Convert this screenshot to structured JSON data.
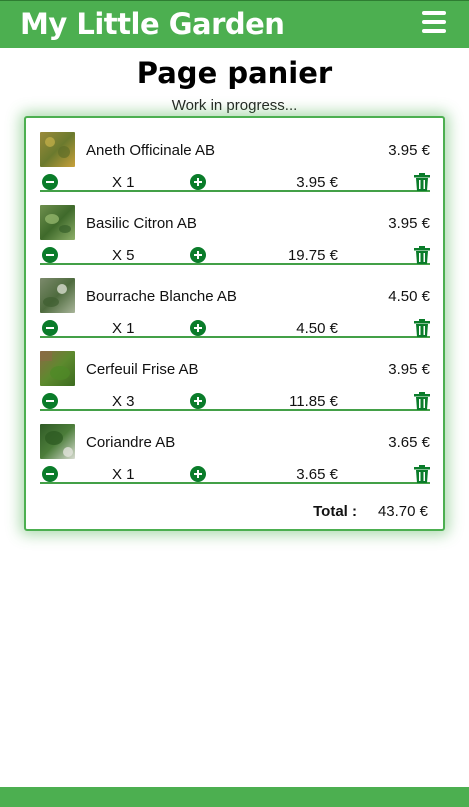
{
  "header": {
    "brand": "My Little Garden",
    "menu_icon": "hamburger-menu-icon"
  },
  "page": {
    "title": "Page panier",
    "subtitle": "Work in progress..."
  },
  "cart": {
    "items": [
      {
        "name": "Aneth Officinale AB",
        "unit_price": "3.95 €",
        "quantity": "X 1",
        "line_total": "3.95 €"
      },
      {
        "name": "Basilic Citron AB",
        "unit_price": "3.95 €",
        "quantity": "X 5",
        "line_total": "19.75 €"
      },
      {
        "name": "Bourrache Blanche AB",
        "unit_price": "4.50 €",
        "quantity": "X 1",
        "line_total": "4.50 €"
      },
      {
        "name": "Cerfeuil Frise AB",
        "unit_price": "3.95 €",
        "quantity": "X 3",
        "line_total": "11.85 €"
      },
      {
        "name": "Coriandre AB",
        "unit_price": "3.65 €",
        "quantity": "X 1",
        "line_total": "3.65 €"
      }
    ],
    "total_label": "Total :",
    "total_value": "43.70 €"
  },
  "colors": {
    "brand_green": "#4caf50",
    "button_green": "#0a7c2a"
  }
}
